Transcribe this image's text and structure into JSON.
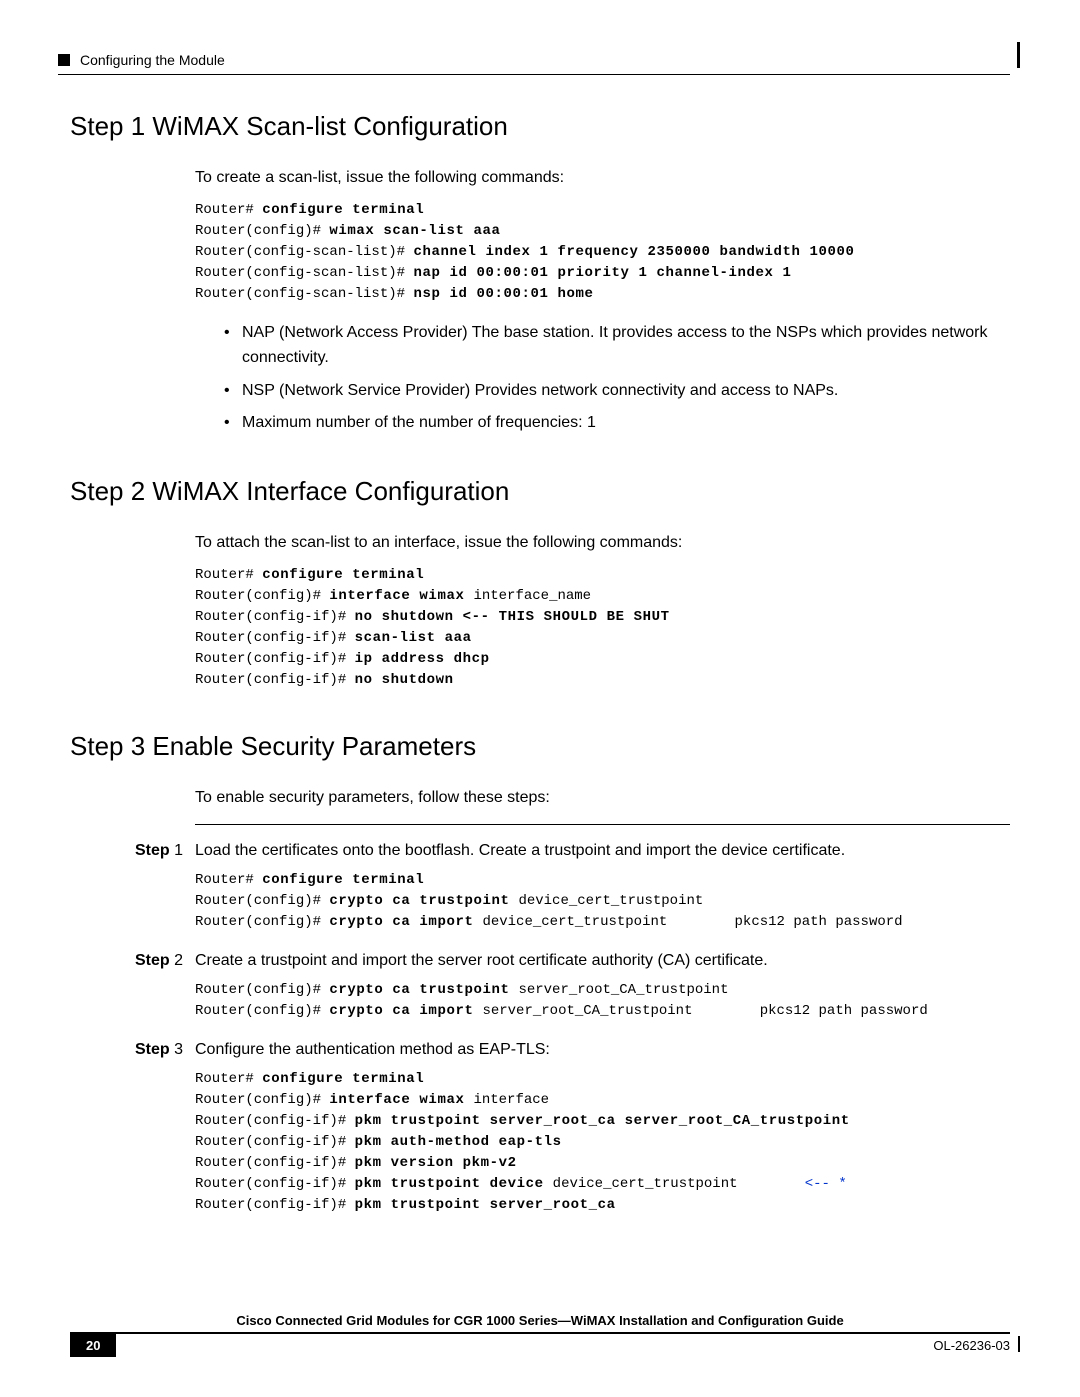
{
  "header": {
    "section_title": "Configuring the Module"
  },
  "step1": {
    "heading": "Step 1 WiMAX Scan-list Configuration",
    "intro": "To create a scan-list, issue the following commands:",
    "code": {
      "l1_prompt": "Router# ",
      "l1_cmd": "configure terminal",
      "l2_prompt": "Router(config)# ",
      "l2_cmd": "wimax scan-list aaa",
      "l3_prompt": "Router(config-scan-list)# ",
      "l3_cmd": "channel index 1 frequency 2350000 bandwidth 10000",
      "l4_prompt": "Router(config-scan-list)# ",
      "l4_cmd": "nap id 00:00:01 priority 1 channel-index 1",
      "l5_prompt": "Router(config-scan-list)# ",
      "l5_cmd": "nsp id 00:00:01 home"
    },
    "notes": {
      "n1": "NAP (Network Access Provider) The base station. It provides access to the NSPs which provides network connectivity.",
      "n2": "NSP (Network Service Provider) Provides network connectivity and access to NAPs.",
      "n3": "Maximum number of the number of frequencies: 1"
    }
  },
  "step2": {
    "heading": "Step 2 WiMAX Interface Configuration",
    "intro": "To attach the scan-list to an interface, issue the following commands:",
    "code": {
      "l1_prompt": "Router# ",
      "l1_cmd": "configure terminal",
      "l2_prompt": "Router(config)# ",
      "l2_cmd": "interface wimax ",
      "l2_arg": "interface_name",
      "l3_prompt": "Router(config-if)# ",
      "l3_cmd": "no shutdown <-- THIS SHOULD BE SHUT",
      "l4_prompt": "Router(config-if)# ",
      "l4_cmd": "scan-list aaa",
      "l5_prompt": "Router(config-if)# ",
      "l5_cmd": "ip address dhcp",
      "l6_prompt": "Router(config-if)# ",
      "l6_cmd": "no shutdown"
    }
  },
  "step3": {
    "heading": "Step 3 Enable Security Parameters",
    "intro": "To enable security parameters, follow these steps:",
    "s1_label": "Step 1",
    "s1_text": "Load the certificates onto the bootflash. Create a trustpoint and import the device certificate.",
    "s1_code": {
      "l1_prompt": "Router# ",
      "l1_cmd": "configure terminal",
      "l2_prompt": "Router(config)# ",
      "l2_cmd": "crypto ca trustpoint ",
      "l2_arg": "device_cert_trustpoint",
      "l3_prompt": "Router(config)# ",
      "l3_cmd": "crypto ca import ",
      "l3_arg1": "device_cert_trustpoint",
      "l3_spacer": "        ",
      "l3_arg2": "pkcs12 path password"
    },
    "s2_label": "Step 2",
    "s2_text": "Create a trustpoint and import the server root certificate authority (CA) certificate.",
    "s2_code": {
      "l1_prompt": "Router(config)# ",
      "l1_cmd": "crypto ca trustpoint ",
      "l1_arg": "server_root_CA_trustpoint",
      "l2_prompt": "Router(config)# ",
      "l2_cmd": "crypto ca import ",
      "l2_arg1": "server_root_CA_trustpoint",
      "l2_spacer": "        ",
      "l2_arg2": "pkcs12 path password"
    },
    "s3_label": "Step 3",
    "s3_text": "Configure the authentication method as EAP-TLS:",
    "s3_code": {
      "l1_prompt": "Router# ",
      "l1_cmd": "configure terminal",
      "l2_prompt": "Router(config)# ",
      "l2_cmd": "interface wimax ",
      "l2_arg": "interface",
      "l3_prompt": "Router(config-if)# ",
      "l3_cmd": "pkm trustpoint server_root_ca server_root_CA_trustpoint",
      "l4_prompt": "Router(config-if)# ",
      "l4_cmd": "pkm auth-method eap-tls",
      "l5_prompt": "Router(config-if)# ",
      "l5_cmd": "pkm version pkm-v2",
      "l6_prompt": "Router(config-if)# ",
      "l6_cmd": "pkm trustpoint device ",
      "l6_arg": "device_cert_trustpoint",
      "l6_spacer": "        ",
      "l6_note": "<-- *",
      "l7_prompt": "Router(config-if)# ",
      "l7_cmd": "pkm trustpoint server_root_ca"
    }
  },
  "footer": {
    "guide": "Cisco Connected Grid Modules for CGR 1000 Series—WiMAX Installation and Configuration Guide",
    "page_number": "20",
    "doc_id": "OL-26236-03"
  }
}
